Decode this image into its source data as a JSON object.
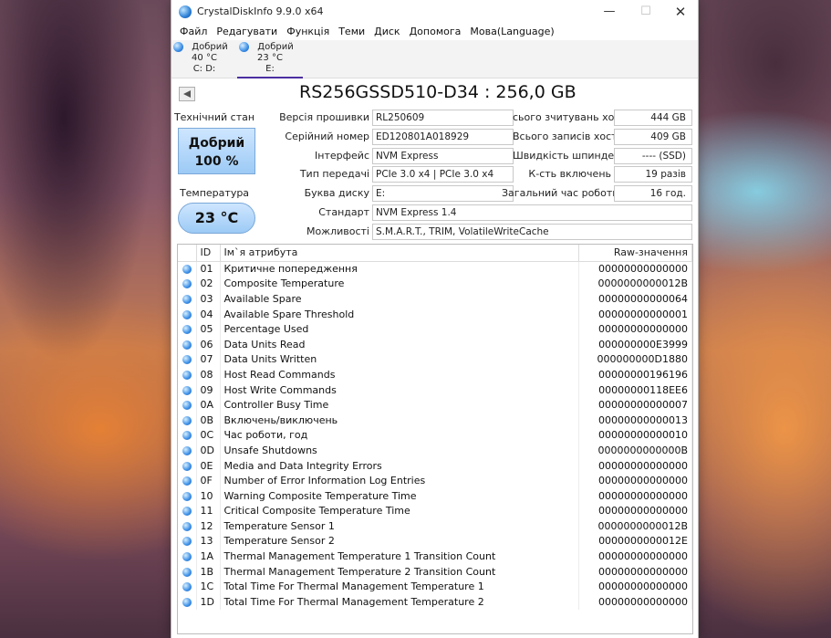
{
  "window": {
    "title": "CrystalDiskInfo 9.9.0 x64",
    "min_symbol": "—",
    "max_symbol": "☐",
    "close_symbol": "✕"
  },
  "menu": [
    "Файл",
    "Редагувати",
    "Функція",
    "Теми",
    "Диск",
    "Допомога",
    "Мова(Language)"
  ],
  "drives": [
    {
      "status": "Добрий",
      "temp": "40 °C",
      "letters": "C: D:"
    },
    {
      "status": "Добрий",
      "temp": "23 °C",
      "letters": "E:"
    }
  ],
  "model": "RS256GSSD510-D34 : 256,0 GB",
  "health": {
    "label": "Технічний стан",
    "status": "Добрий",
    "percent": "100 %"
  },
  "temperature": {
    "label": "Температура",
    "value": "23 °C"
  },
  "fields_left": [
    {
      "label": "Версія прошивки",
      "value": "RL250609"
    },
    {
      "label": "Серійний номер",
      "value": "ED120801A018929"
    },
    {
      "label": "Інтерфейс",
      "value": "NVM Express"
    },
    {
      "label": "Тип передачі",
      "value": "PCIe 3.0 x4 | PCIe 3.0 x4"
    },
    {
      "label": "Буква диску",
      "value": "E:"
    }
  ],
  "fields_right": [
    {
      "label": "сього зчитувань хоста",
      "value": "444 GB"
    },
    {
      "label": "Всього записів хоста",
      "value": "409 GB"
    },
    {
      "label": "Швидкість шпинделя",
      "value": "---- (SSD)"
    },
    {
      "label": "К-сть включень",
      "value": "19 разів"
    },
    {
      "label": "Загальний час роботи",
      "value": "16 год."
    }
  ],
  "fields_wide": [
    {
      "label": "Стандарт",
      "value": "NVM Express 1.4"
    },
    {
      "label": "Можливості",
      "value": "S.M.A.R.T., TRIM, VolatileWriteCache"
    }
  ],
  "table": {
    "headers": {
      "id": "ID",
      "name": "Ім`я атрибута",
      "raw": "Raw-значення"
    },
    "rows": [
      {
        "id": "01",
        "name": "Критичне попередження",
        "raw": "00000000000000"
      },
      {
        "id": "02",
        "name": "Composite Temperature",
        "raw": "0000000000012B"
      },
      {
        "id": "03",
        "name": "Available Spare",
        "raw": "00000000000064"
      },
      {
        "id": "04",
        "name": "Available Spare Threshold",
        "raw": "00000000000001"
      },
      {
        "id": "05",
        "name": "Percentage Used",
        "raw": "00000000000000"
      },
      {
        "id": "06",
        "name": "Data Units Read",
        "raw": "000000000E3999"
      },
      {
        "id": "07",
        "name": "Data Units Written",
        "raw": "000000000D1880"
      },
      {
        "id": "08",
        "name": "Host Read Commands",
        "raw": "00000000196196"
      },
      {
        "id": "09",
        "name": "Host Write Commands",
        "raw": "00000000118EE6"
      },
      {
        "id": "0A",
        "name": "Controller Busy Time",
        "raw": "00000000000007"
      },
      {
        "id": "0B",
        "name": "Включень/виключень",
        "raw": "00000000000013"
      },
      {
        "id": "0C",
        "name": "Час роботи, год",
        "raw": "00000000000010"
      },
      {
        "id": "0D",
        "name": "Unsafe Shutdowns",
        "raw": "0000000000000B"
      },
      {
        "id": "0E",
        "name": "Media and Data Integrity Errors",
        "raw": "00000000000000"
      },
      {
        "id": "0F",
        "name": "Number of Error Information Log Entries",
        "raw": "00000000000000"
      },
      {
        "id": "10",
        "name": "Warning Composite Temperature Time",
        "raw": "00000000000000"
      },
      {
        "id": "11",
        "name": "Critical Composite Temperature Time",
        "raw": "00000000000000"
      },
      {
        "id": "12",
        "name": "Temperature Sensor 1",
        "raw": "0000000000012B"
      },
      {
        "id": "13",
        "name": "Temperature Sensor 2",
        "raw": "0000000000012E"
      },
      {
        "id": "1A",
        "name": "Thermal Management Temperature 1 Transition Count",
        "raw": "00000000000000"
      },
      {
        "id": "1B",
        "name": "Thermal Management Temperature 2 Transition Count",
        "raw": "00000000000000"
      },
      {
        "id": "1C",
        "name": "Total Time For Thermal Management Temperature 1",
        "raw": "00000000000000"
      },
      {
        "id": "1D",
        "name": "Total Time For Thermal Management Temperature 2",
        "raw": "00000000000000"
      }
    ]
  }
}
